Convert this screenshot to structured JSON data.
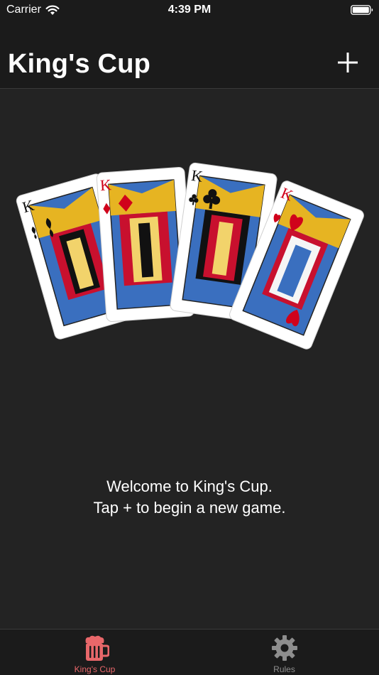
{
  "status_bar": {
    "carrier": "Carrier",
    "time": "4:39 PM"
  },
  "nav": {
    "title": "King's Cup",
    "add_icon": "plus-icon"
  },
  "main": {
    "cards": [
      "K spades",
      "K diamonds",
      "K clubs",
      "K hearts"
    ],
    "welcome_line1": "Welcome to King's Cup.",
    "welcome_line2": "Tap + to begin a new game."
  },
  "tabs": [
    {
      "label": "King's Cup",
      "icon": "beer-mug-icon",
      "selected": true
    },
    {
      "label": "Rules",
      "icon": "gear-icon",
      "selected": false
    }
  ],
  "colors": {
    "background": "#232323",
    "bars": "#1b1b1b",
    "accent": "#e8676a",
    "inactive": "#8e8e8e",
    "card_red": "#d0021b"
  }
}
